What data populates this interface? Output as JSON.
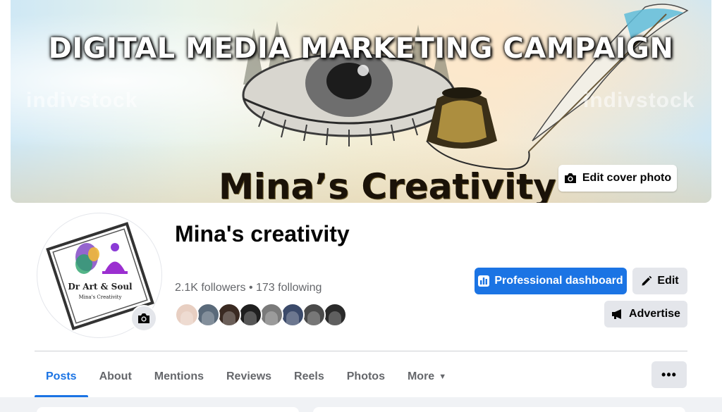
{
  "cover": {
    "title": "DIGITAL MEDIA MARKETING CAMPAIGN",
    "subtitle": "Mina’s Creativity",
    "watermark": "indivstock",
    "edit_cover_label": "Edit cover photo"
  },
  "profile": {
    "name": "Mina's creativity",
    "followers_text": "2.1K followers • 173 following",
    "avatar_logo_text": "Dr Art & Soul",
    "avatar_logo_subtext": "Mina's Creativity"
  },
  "actions": {
    "dashboard_label": "Professional dashboard",
    "edit_label": "Edit",
    "advertise_label": "Advertise"
  },
  "tabs": [
    {
      "label": "Posts",
      "active": true
    },
    {
      "label": "About"
    },
    {
      "label": "Mentions"
    },
    {
      "label": "Reviews"
    },
    {
      "label": "Reels"
    },
    {
      "label": "Photos"
    },
    {
      "label": "More"
    }
  ],
  "more_options_label": "•••",
  "colors": {
    "accent": "#1b74e4",
    "secondary_button": "#e4e6eb",
    "muted_text": "#65676b"
  },
  "follower_avatar_colors": [
    "#e8cfc2",
    "#5a6a7a",
    "#3a2a22",
    "#1f1f1f",
    "#7a7a7a",
    "#3b4a6a",
    "#4a4a4a",
    "#2a2a2a"
  ]
}
